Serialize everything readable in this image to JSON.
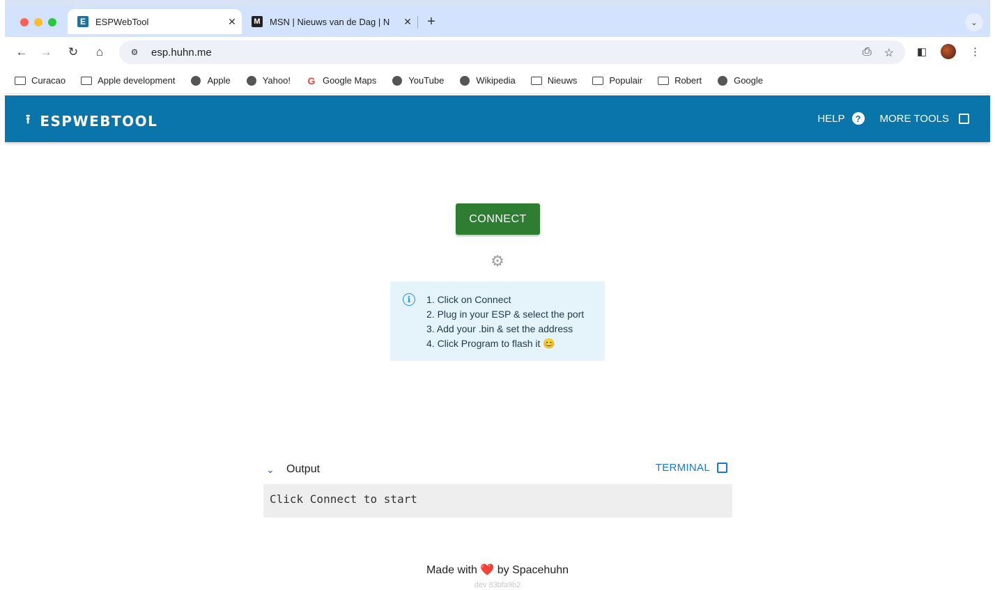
{
  "browser": {
    "tabs": [
      {
        "title": "ESPWebTool",
        "favicon": "E",
        "active": true
      },
      {
        "title": "MSN | Nieuws van de Dag | N",
        "favicon": "M",
        "active": false
      }
    ],
    "url": "esp.huhn.me",
    "bookmarks": [
      {
        "label": "Curacao",
        "icon": "folder-icon"
      },
      {
        "label": "Apple development",
        "icon": "folder-icon"
      },
      {
        "label": "Apple",
        "icon": "globe-icon"
      },
      {
        "label": "Yahoo!",
        "icon": "globe-icon"
      },
      {
        "label": "Google Maps",
        "icon": "google-icon"
      },
      {
        "label": "YouTube",
        "icon": "globe-icon"
      },
      {
        "label": "Wikipedia",
        "icon": "globe-icon"
      },
      {
        "label": "Nieuws",
        "icon": "folder-icon"
      },
      {
        "label": "Populair",
        "icon": "folder-icon"
      },
      {
        "label": "Robert",
        "icon": "folder-icon"
      },
      {
        "label": "Google",
        "icon": "globe-icon"
      }
    ]
  },
  "app": {
    "logo_text": "ESPWEBTOOL",
    "help_label": "HELP",
    "more_tools_label": "MORE TOOLS",
    "connect_label": "CONNECT",
    "steps": [
      "1. Click on Connect",
      "2. Plug in your ESP & select the port",
      "3. Add your .bin & set the address",
      "4. Click Program to flash it 😊"
    ],
    "output_label": "Output",
    "terminal_label": "TERMINAL",
    "output_text": "Click Connect to start",
    "footer_prefix": "Made with",
    "footer_suffix": "by Spacehuhn",
    "version": "dev 83bfa9b2"
  },
  "colors": {
    "header": "#0a75ab",
    "connect": "#2e7d32",
    "info_bg": "#e5f4fb",
    "link": "#1976d2"
  }
}
